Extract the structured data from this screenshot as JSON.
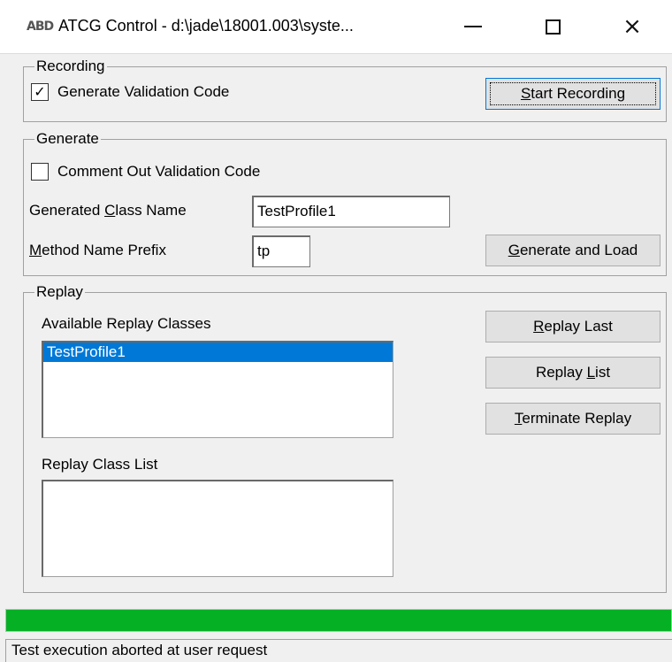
{
  "window": {
    "icon_text": "ABD",
    "title": "ATCG Control - d:\\jade\\18001.003\\syste...",
    "minimize": "minimize",
    "maximize": "maximize",
    "close": "×"
  },
  "recording": {
    "legend": "Recording",
    "generate_validation_checked": true,
    "generate_validation_mark": "✓",
    "generate_validation_label": "Generate Validation Code",
    "start_btn": {
      "mnemonic": "S",
      "rest": "tart Recording"
    }
  },
  "generate": {
    "legend": "Generate",
    "comment_out_checked": false,
    "comment_out_label": "Comment Out Validation Code",
    "class_name_label": {
      "pre": "Generated ",
      "mnemonic": "C",
      "rest": "lass Name"
    },
    "class_name_value": "TestProfile1",
    "prefix_label": {
      "mnemonic": "M",
      "rest": "ethod Name Prefix"
    },
    "prefix_value": "tp",
    "generate_btn": {
      "mnemonic": "G",
      "rest": "enerate and Load"
    }
  },
  "replay": {
    "legend": "Replay",
    "available_label": "Available Replay Classes",
    "available_items": [
      "TestProfile1"
    ],
    "selected_index": 0,
    "class_list_label": "Replay Class List",
    "class_list_items": [],
    "replay_last_btn": {
      "mnemonic": "R",
      "rest": "eplay Last"
    },
    "replay_list_btn": {
      "pre": "Replay ",
      "mnemonic": "L",
      "rest": "ist"
    },
    "terminate_btn": {
      "mnemonic": "T",
      "rest": "erminate Replay"
    }
  },
  "progress": {
    "value": 1.0,
    "color": "#06b025"
  },
  "status_text": "Test execution aborted at user request"
}
